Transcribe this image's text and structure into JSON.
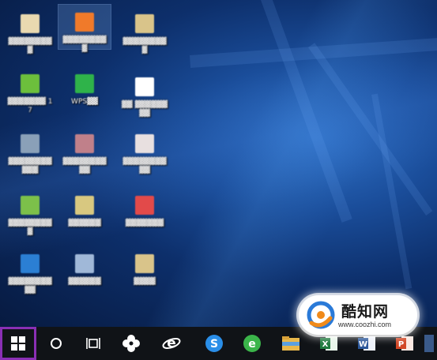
{
  "desktop": {
    "icons": [
      {
        "label": "▓▓▓▓▓▓▓▓ ▓",
        "color": "#e9d9b0"
      },
      {
        "label": "▓▓▓▓▓▓▓▓▓",
        "color": "#f07a2a"
      },
      {
        "label": "▓▓▓▓▓▓▓▓▓",
        "color": "#d9c48a"
      },
      {
        "label": "▓▓▓▓▓▓▓ 17",
        "color": "#6cbf3c"
      },
      {
        "label": "WPS▓▓",
        "color": "#2fb34a"
      },
      {
        "label": "▓▓ ▓▓▓▓▓▓▓▓",
        "color": "#ffffff"
      },
      {
        "label": "▓▓▓▓▓▓▓▓ ▓▓▓",
        "color": "#8aa0b8"
      },
      {
        "label": "▓▓▓▓▓▓▓▓▓▓",
        "color": "#c0808a"
      },
      {
        "label": "▓▓▓▓▓▓▓▓▓▓",
        "color": "#e8e0e0"
      },
      {
        "label": "▓▓▓▓▓▓▓▓ ▓",
        "color": "#7cc04a"
      },
      {
        "label": "▓▓▓▓▓▓",
        "color": "#d8c880"
      },
      {
        "label": "▓▓▓▓▓▓▓",
        "color": "#e24a4a"
      },
      {
        "label": "▓▓▓▓▓▓▓▓ ▓▓",
        "color": "#2b7fd4"
      },
      {
        "label": "▓▓▓▓▓▓",
        "color": "#a0b8d8"
      },
      {
        "label": "▓▓▓▓",
        "color": "#d9c48a"
      }
    ]
  },
  "taskbar": {
    "items": [
      {
        "name": "start-button",
        "icon": "windows-logo-icon"
      },
      {
        "name": "cortana-search-button",
        "icon": "circle-icon"
      },
      {
        "name": "task-view-button",
        "icon": "task-view-icon"
      },
      {
        "name": "fan-app-button",
        "icon": "fan-icon"
      },
      {
        "name": "internet-explorer-button",
        "icon": "ie-icon"
      },
      {
        "name": "sogou-browser-button",
        "icon": "sogou-icon"
      },
      {
        "name": "360-browser-button",
        "icon": "360-browser-icon"
      },
      {
        "name": "file-explorer-button",
        "icon": "folder-icon"
      },
      {
        "name": "excel-button",
        "icon": "excel-icon"
      },
      {
        "name": "word-button",
        "icon": "word-icon"
      },
      {
        "name": "powerpoint-button",
        "icon": "powerpoint-icon"
      }
    ]
  },
  "watermark": {
    "brand": "酷知网",
    "url": "www.coozhi.com"
  },
  "colors": {
    "start_highlight": "#8a2fb4",
    "taskbar_bg": "#101317",
    "desktop_bg": "#0d2f6b"
  }
}
